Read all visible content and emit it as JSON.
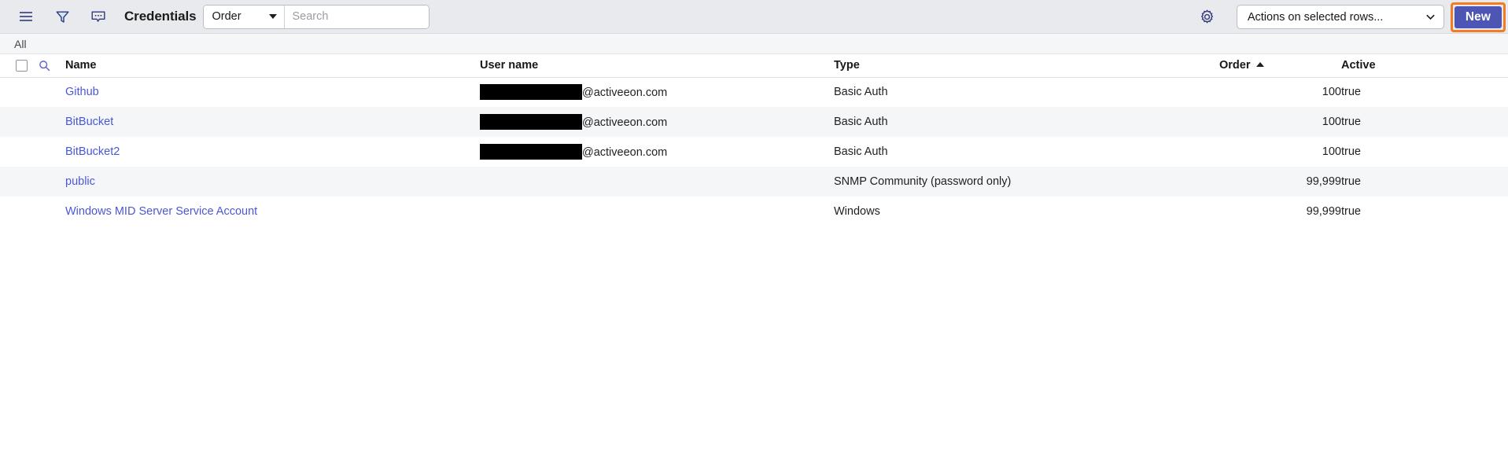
{
  "toolbar": {
    "icons": {
      "menu": "hamburger-menu-icon",
      "filter": "filter-funnel-icon",
      "comment": "comment-bubble-icon",
      "settings": "gear-icon"
    },
    "title": "Credentials",
    "order_select": {
      "value": "Order"
    },
    "search": {
      "value": "",
      "placeholder": "Search"
    },
    "actions_select": {
      "value": "Actions on selected rows..."
    },
    "new_button": "New",
    "accent_new_bg": "#4d55b5",
    "accent_highlight": "#f47b20"
  },
  "breadcrumb": {
    "items": [
      "All"
    ]
  },
  "table": {
    "columns": [
      {
        "key": "name",
        "label": "Name",
        "align": "left",
        "sorted": false
      },
      {
        "key": "user",
        "label": "User name",
        "align": "left",
        "sorted": false
      },
      {
        "key": "type",
        "label": "Type",
        "align": "left",
        "sorted": false
      },
      {
        "key": "order",
        "label": "Order",
        "align": "right",
        "sorted": true,
        "sort_dir": "asc"
      },
      {
        "key": "active",
        "label": "Active",
        "align": "left",
        "sorted": false
      }
    ],
    "rows": [
      {
        "name": "Github",
        "user_redacted": true,
        "user_domain": "@activeeon.com",
        "type": "Basic Auth",
        "order": "100",
        "active": "true"
      },
      {
        "name": "BitBucket",
        "user_redacted": true,
        "user_domain": "@activeeon.com",
        "type": "Basic Auth",
        "order": "100",
        "active": "true"
      },
      {
        "name": "BitBucket2",
        "user_redacted": true,
        "user_domain": "@activeeon.com",
        "type": "Basic Auth",
        "order": "100",
        "active": "true"
      },
      {
        "name": "public",
        "user_redacted": false,
        "user_domain": "",
        "type": "SNMP Community (password only)",
        "order": "99,999",
        "active": "true"
      },
      {
        "name": "Windows MID Server Service Account",
        "user_redacted": false,
        "user_domain": "",
        "type": "Windows",
        "order": "99,999",
        "active": "true"
      }
    ]
  }
}
